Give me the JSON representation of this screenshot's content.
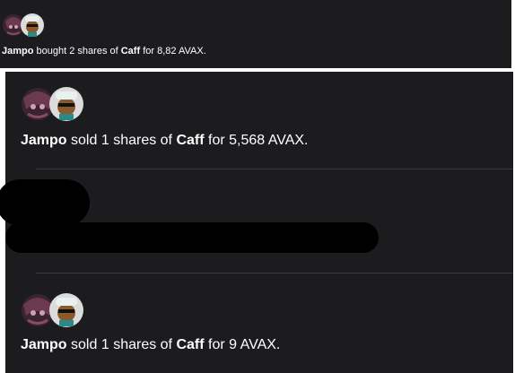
{
  "top_item": {
    "trader": "Jampo",
    "action": "bought",
    "qty_text": "2 shares of",
    "asset": "Caff",
    "for_text": "for",
    "price": "8,82 AVAX."
  },
  "feed": [
    {
      "trader": "Jampo",
      "action": "sold",
      "qty_text": "1 shares of",
      "asset": "Caff",
      "for_text": "for",
      "price": "5,568 AVAX."
    },
    {
      "trader": "Jampo",
      "action": "sold",
      "qty_text": "1 shares of",
      "asset": "Caff",
      "for_text": "for",
      "price": "9 AVAX."
    }
  ],
  "colors": {
    "background": "#1c1c1f",
    "text": "#ffffff",
    "divider": "#3a3a3f",
    "redaction": "#000000"
  },
  "icons": [
    "trader-avatar-icon",
    "subject-avatar-icon"
  ]
}
